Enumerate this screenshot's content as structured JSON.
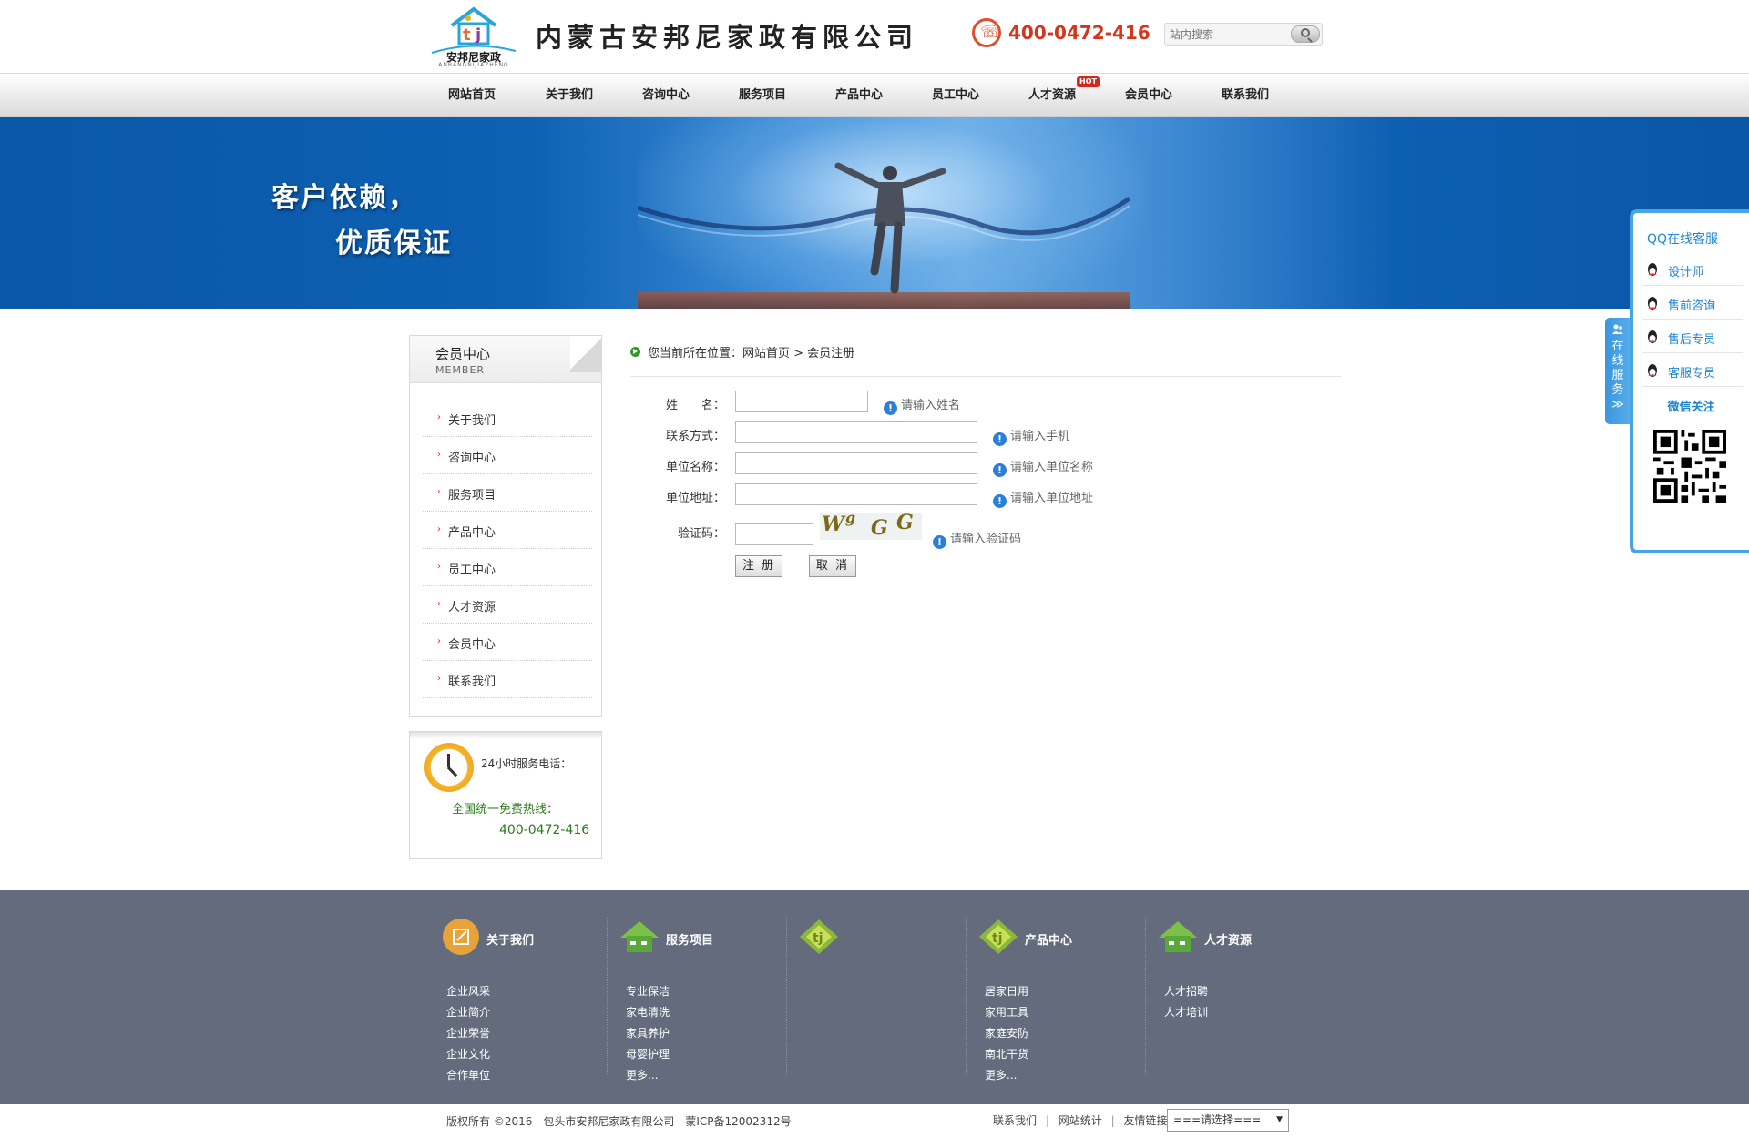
{
  "header": {
    "logo_text": "安邦尼家政",
    "logo_sub": "ANBANGNIJIAZHENG",
    "company_name": "内蒙古安邦尼家政有限公司",
    "hotline": "400-0472-416",
    "search_placeholder": "站内搜索"
  },
  "nav": {
    "items": [
      "网站首页",
      "关于我们",
      "咨询中心",
      "服务项目",
      "产品中心",
      "员工中心",
      "人才资源",
      "会员中心",
      "联系我们"
    ],
    "hot_badge": "HOT"
  },
  "banner": {
    "line1": "客户依赖，",
    "line2": "优质保证"
  },
  "sidebar": {
    "title": "会员中心",
    "subtitle": "MEMBER",
    "items": [
      "关于我们",
      "咨询中心",
      "服务项目",
      "产品中心",
      "员工中心",
      "人才资源",
      "会员中心",
      "联系我们"
    ]
  },
  "service": {
    "label": "24小时服务电话：",
    "free_line": "全国统一免费热线：",
    "phone": "400-0472-416"
  },
  "breadcrumb": {
    "text": "您当前所在位置：网站首页 > 会员注册"
  },
  "form": {
    "name_label": "姓　　名：",
    "name_hint": "请输入姓名",
    "contact_label": "联系方式：",
    "contact_hint": "请输入手机",
    "unit_label": "单位名称：",
    "unit_hint": "请输入单位名称",
    "address_label": "单位地址：",
    "address_hint": "请输入单位地址",
    "captcha_label": "验证码：",
    "captcha_hint": "请输入验证码",
    "captcha_chars": [
      "W",
      "g",
      "G",
      "G"
    ],
    "submit_label": "注 册",
    "cancel_label": "取 消"
  },
  "qq": {
    "title": "QQ在线客服",
    "items": [
      "设计师",
      "售前咨询",
      "售后专员",
      "客服专员"
    ],
    "wechat": "微信关注",
    "tab_label": "在线服务≫"
  },
  "footer": {
    "columns": [
      {
        "title": "关于我们",
        "links": [
          "企业风采",
          "企业简介",
          "企业荣誉",
          "企业文化",
          "合作单位"
        ]
      },
      {
        "title": "服务项目",
        "links": [
          "专业保洁",
          "家电清洗",
          "家具养护",
          "母婴护理",
          "更多..."
        ]
      },
      {
        "title": "",
        "links": []
      },
      {
        "title": "产品中心",
        "links": [
          "居家日用",
          "家用工具",
          "家庭安防",
          "南北干货",
          "更多..."
        ]
      },
      {
        "title": "人才资源",
        "links": [
          "人才招聘",
          "人才培训"
        ]
      }
    ],
    "copyright": "版权所有 ©2016　包头市安邦尼家政有限公司　蒙ICP备12002312号",
    "bottom_links": [
      "联系我们",
      "网站统计",
      "友情链接"
    ],
    "select_value": "===请选择==="
  },
  "colors": {
    "banner_blue": "#0a58a8",
    "footer_gray": "#636b7c",
    "accent_red": "#d4351c",
    "qq_blue": "#1d86d6",
    "hint_blue": "#2a7fd6",
    "green_text": "#2c7a1d"
  }
}
